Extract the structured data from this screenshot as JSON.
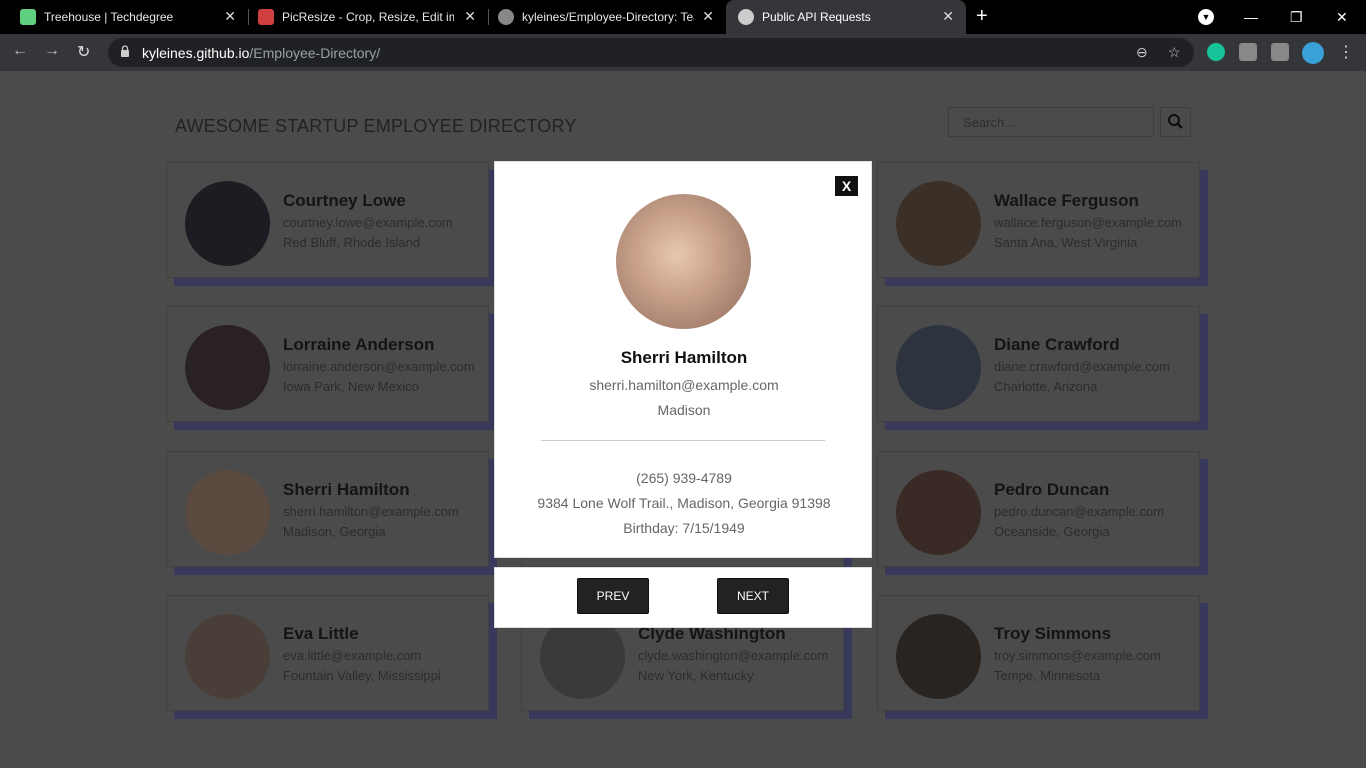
{
  "browser": {
    "tabs": [
      {
        "title": "Treehouse | Techdegree",
        "favicon_color": "#5fcf80"
      },
      {
        "title": "PicResize - Crop, Resize, Edit ima",
        "favicon_color": "#d04040"
      },
      {
        "title": "kyleines/Employee-Directory: Tea",
        "favicon_color": "#888888"
      },
      {
        "title": "Public API Requests",
        "favicon_color": "#cccccc"
      }
    ],
    "new_tab_label": "+",
    "url_host": "kyleines.github.io",
    "url_path": "/Employee-Directory/",
    "window_controls": {
      "minimize": "—",
      "maximize": "❐",
      "close": "✕"
    }
  },
  "page": {
    "title": "AWESOME STARTUP EMPLOYEE DIRECTORY",
    "search_placeholder": "Search...",
    "search_icon": "magnifier-icon"
  },
  "employees": [
    {
      "name": "Courtney Lowe",
      "email": "courtney.lowe@example.com",
      "location": "Red Bluff, Rhode Island",
      "avatar_color": "#1c1c22"
    },
    {
      "name": "",
      "email": "",
      "location": "",
      "avatar_color": "#444444"
    },
    {
      "name": "Wallace Ferguson",
      "email": "wallace.ferguson@example.com",
      "location": "Santa Ana, West Virginia",
      "avatar_color": "#3a3028"
    },
    {
      "name": "Lorraine Anderson",
      "email": "lorraine.anderson@example.com",
      "location": "Iowa Park, New Mexico",
      "avatar_color": "#2a2222"
    },
    {
      "name": "",
      "email": "",
      "location": "",
      "avatar_color": "#444444"
    },
    {
      "name": "Diane Crawford",
      "email": "diane.crawford@example.com",
      "location": "Charlotte, Arizona",
      "avatar_color": "#2e3340"
    },
    {
      "name": "Sherri Hamilton",
      "email": "sherri.hamilton@example.com",
      "location": "Madison, Georgia",
      "avatar_color": "#5a4a40"
    },
    {
      "name": "",
      "email": "",
      "location": "",
      "avatar_color": "#444444"
    },
    {
      "name": "Pedro Duncan",
      "email": "pedro.duncan@example.com",
      "location": "Oceanside, Georgia",
      "avatar_color": "#3a2a25"
    },
    {
      "name": "Eva Little",
      "email": "eva.little@example.com",
      "location": "Fountain Valley, Mississippi",
      "avatar_color": "#4a3e38"
    },
    {
      "name": "Clyde Washington",
      "email": "clyde.washington@example.com",
      "location": "New York, Kentucky",
      "avatar_color": "#3a3a3a"
    },
    {
      "name": "Troy Simmons",
      "email": "troy.simmons@example.com",
      "location": "Tempe, Minnesota",
      "avatar_color": "#2a2420"
    }
  ],
  "modal": {
    "close_label": "X",
    "name": "Sherri Hamilton",
    "email": "sherri.hamilton@example.com",
    "city": "Madison",
    "phone": "(265) 939-4789",
    "address": "9384 Lone Wolf Trail., Madison, Georgia 91398",
    "birthday": "Birthday: 7/15/1949",
    "prev_label": "PREV",
    "next_label": "NEXT",
    "avatar_color": "#c8a08a"
  }
}
